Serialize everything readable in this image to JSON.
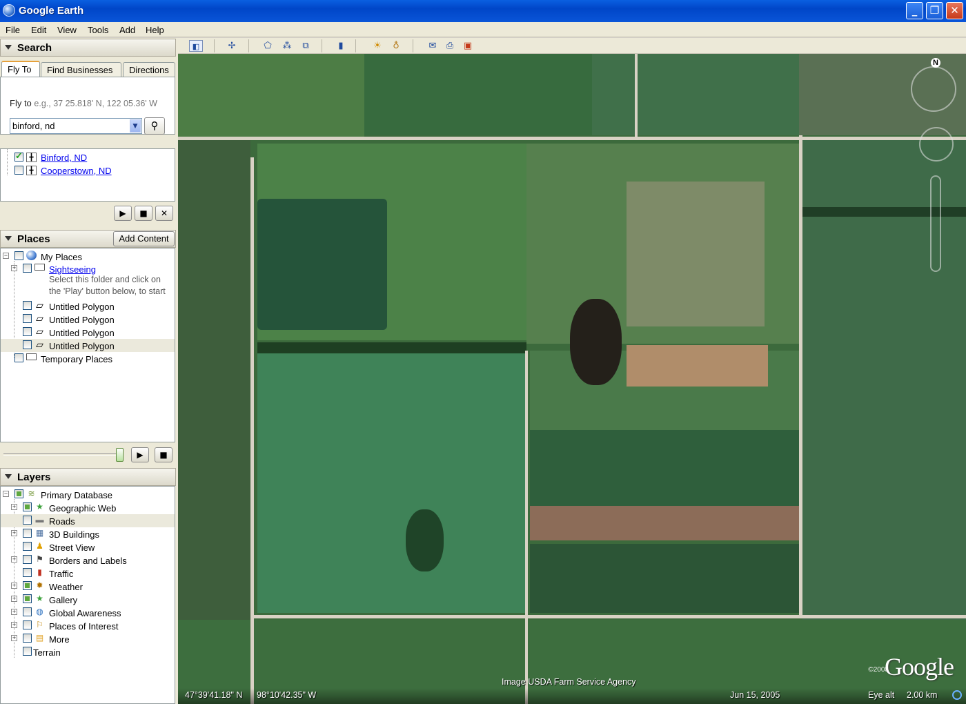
{
  "window": {
    "title": "Google Earth"
  },
  "menu": [
    "File",
    "Edit",
    "View",
    "Tools",
    "Add",
    "Help"
  ],
  "search": {
    "title": "Search",
    "tabs": [
      "Fly To",
      "Find Businesses",
      "Directions"
    ],
    "flyto_label": "Fly to",
    "flyto_hint": "e.g., 37 25.818' N, 122 05.36' W",
    "input_value": "binford, nd",
    "results": [
      {
        "label": "Binford, ND",
        "checked": true
      },
      {
        "label": "Cooperstown, ND",
        "checked": false
      }
    ]
  },
  "places": {
    "title": "Places",
    "add_content_label": "Add Content",
    "items": [
      {
        "label": "My Places"
      },
      {
        "label": "Sightseeing"
      },
      {
        "label": "Select this folder and click on"
      },
      {
        "label": "the 'Play' button below, to start"
      },
      {
        "label": "Untitled Polygon"
      },
      {
        "label": "Untitled Polygon"
      },
      {
        "label": "Untitled Polygon"
      },
      {
        "label": "Untitled Polygon"
      },
      {
        "label": "Temporary Places"
      }
    ]
  },
  "layers": {
    "title": "Layers",
    "items": [
      {
        "label": "Primary Database",
        "icon": "database-icon"
      },
      {
        "label": "Geographic Web",
        "icon": "star-icon"
      },
      {
        "label": "Roads",
        "icon": "road-icon"
      },
      {
        "label": "3D Buildings",
        "icon": "building-icon"
      },
      {
        "label": "Street View",
        "icon": "pegman-icon"
      },
      {
        "label": "Borders and Labels",
        "icon": "flag-icon"
      },
      {
        "label": "Traffic",
        "icon": "traffic-light-icon"
      },
      {
        "label": "Weather",
        "icon": "sun-icon"
      },
      {
        "label": "Gallery",
        "icon": "star-icon"
      },
      {
        "label": "Global Awareness",
        "icon": "globe-icon"
      },
      {
        "label": "Places of Interest",
        "icon": "pin-icon"
      },
      {
        "label": "More",
        "icon": "folder-icon"
      },
      {
        "label": "Terrain",
        "icon": ""
      }
    ]
  },
  "map": {
    "imagery_credit": "Image USDA Farm Service Agency",
    "latitude": "47°39'41.18\" N",
    "longitude": "98°10'42.35\" W",
    "imagery_date": "Jun 15, 2005",
    "eye_alt_label": "Eye alt",
    "eye_alt_value": "2.00 km",
    "copyright": "©2008",
    "logo": "Google",
    "compass_letter": "N"
  }
}
